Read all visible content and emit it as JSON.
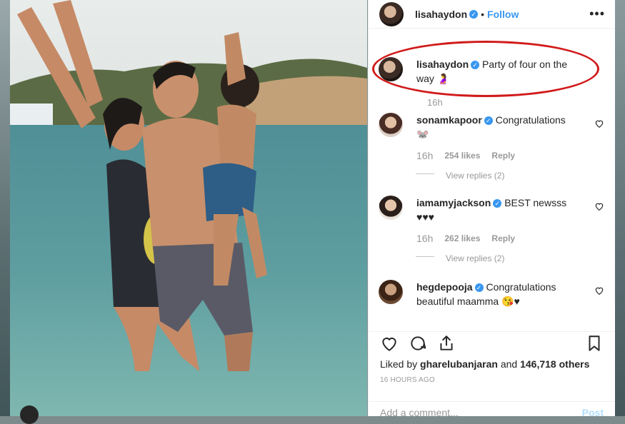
{
  "header": {
    "username": "lisahaydon",
    "separator": "•",
    "follow_label": "Follow",
    "more_label": "•••"
  },
  "caption": {
    "username": "lisahaydon",
    "text": "Party of four on the way 🤰",
    "time": "16h"
  },
  "comments": [
    {
      "username": "sonamkapoor",
      "text": "Congratulations 🐭",
      "time": "16h",
      "likes": "254 likes",
      "reply": "Reply",
      "view_replies": "View replies (2)"
    },
    {
      "username": "iamamyjackson",
      "text": "BEST newsss ♥♥♥",
      "time": "16h",
      "likes": "262 likes",
      "reply": "Reply",
      "view_replies": "View replies (2)"
    },
    {
      "username": "hegdepooja",
      "text": "Congratulations beautiful maamma 😘♥"
    }
  ],
  "actions": {
    "liked_by_prefix": "Liked by",
    "liked_by_user": "gharelubanjaran",
    "liked_by_mid": "and",
    "liked_by_count": "146,718 others",
    "posted_time": "16 HOURS AGO"
  },
  "add_comment": {
    "placeholder": "Add a comment...",
    "post_label": "Post"
  },
  "colors": {
    "accent": "#3897f0",
    "highlight": "#d11a1a",
    "muted": "#999999"
  }
}
